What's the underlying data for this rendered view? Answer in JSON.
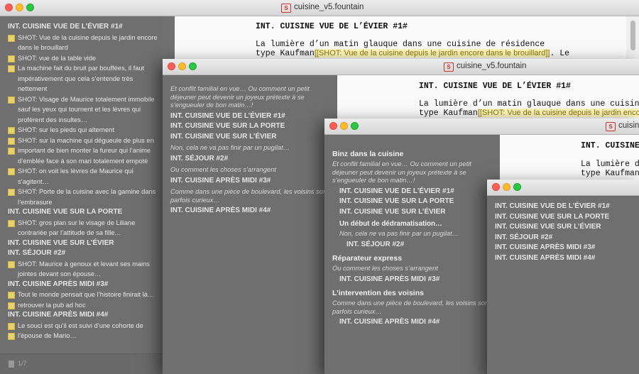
{
  "filename": "cuisine_v5.fountain",
  "app_icon": "S",
  "footer_page": "1/7",
  "win1": {
    "items": [
      {
        "kind": "scene",
        "text": "INT. CUISINE VUE DE L’ÉVIER #1#"
      },
      {
        "kind": "shot",
        "text": "SHOT: Vue de la cuisine depuis le jardin encore dans le brouillard"
      },
      {
        "kind": "shot",
        "text": "SHOT: vue de la table vide"
      },
      {
        "kind": "shot",
        "text": "La machine fait du bruit par bouffées, il faut impérativement que cela s’entende très nettement"
      },
      {
        "kind": "shot",
        "text": "SHOT: Visage de Maurice totalement immobile sauf les yeux qui tournent et les lèvres qui profèrent des insultes…"
      },
      {
        "kind": "shot",
        "text": "SHOT: sur les pieds qui alternent"
      },
      {
        "kind": "shot",
        "text": "SHOT: sur la machine qui dégueule de plus en"
      },
      {
        "kind": "shot",
        "text": "important de bien monter la fureur qui l’anime d’emblée face à son mari totalement empoté"
      },
      {
        "kind": "shot",
        "text": "SHOT: on voit les lèvres de Maurice qui s’agitent…"
      },
      {
        "kind": "shot",
        "text": "SHOT: Porte de la cuisine avec la gamine dans l’embrasure"
      },
      {
        "kind": "scene",
        "text": "INT. CUISINE VUE SUR LA PORTE"
      },
      {
        "kind": "shot",
        "text": "SHOT: gros plan sur le visage de Liliane contrariée par l’attitude de sa fille…"
      },
      {
        "kind": "scene",
        "text": "INT. CUISINE VUE SUR L’ÉVIER"
      },
      {
        "kind": "scene",
        "text": "INT. SÉJOUR #2#"
      },
      {
        "kind": "shot",
        "text": "SHOT: Maurice à genoux et levant ses mains jointes devant son épouse…"
      },
      {
        "kind": "scene",
        "text": "INT. CUISINE APRÈS MIDI #3#"
      },
      {
        "kind": "shot",
        "text": "Tout le monde pensait que l’histoire finirait là…"
      },
      {
        "kind": "shot",
        "text": "retrouver la pub ad hoc"
      },
      {
        "kind": "scene",
        "text": "INT. CUISINE APRÈS MIDI #4#"
      },
      {
        "kind": "shot",
        "text": "Le souci est qu’il est suivi d’une cohorte de"
      },
      {
        "kind": "shot",
        "text": "l’épouse de Mario…"
      }
    ],
    "editor": {
      "heading": "INT. CUISINE VUE DE L’ÉVIER #1#",
      "line1": "La lumière d’un matin glauque dans une cuisine de résidence",
      "line2_pre": "type Kaufman",
      "line2_note": "[[SHOT: Vue de la cuisine depuis le jardin encore dans le brouillard]]",
      "line2_post": ". Le"
    }
  },
  "win2": {
    "items": [
      {
        "kind": "syn",
        "text": "Et conflit familial en vue… Ou comment un petit déjeuner peut devenir un joyeux prétexte à se s’engueuler de bon matin…!"
      },
      {
        "kind": "scene",
        "text": "INT. CUISINE VUE DE L’ÉVIER #1#"
      },
      {
        "kind": "scene",
        "text": "INT. CUISINE VUE SUR LA PORTE"
      },
      {
        "kind": "scene",
        "text": "INT. CUISINE VUE SUR L’ÉVIER"
      },
      {
        "kind": "syn",
        "text": "Non, cela ne va pas finir par un pugilat…"
      },
      {
        "kind": "scene",
        "text": "INT. SÉJOUR #2#"
      },
      {
        "kind": "syn",
        "text": "Ou comment les choses s’arrangent"
      },
      {
        "kind": "scene",
        "text": "INT. CUISINE APRÈS MIDI #3#"
      },
      {
        "kind": "syn",
        "text": "Comme dans une pièce de boulevard, les voisins sont parfois curieux…"
      },
      {
        "kind": "scene",
        "text": "INT. CUISINE APRÈS MIDI #4#"
      }
    ],
    "editor": {
      "heading": "INT. CUISINE VUE DE L’ÉVIER #1#",
      "line1": "La lumière d’un matin glauque dans une cuisine",
      "line2_pre": "type Kaufman",
      "line2_note": "[[SHOT: Vue de la cuisine depuis le jardin encore dans le"
    }
  },
  "win3": {
    "items": [
      {
        "kind": "sect",
        "text": "Binz dans la cuisine"
      },
      {
        "kind": "syn",
        "text": "Et conflit familial en vue… Ou comment un petit déjeuner peut devenir un joyeux prétexte à se s’engueuler de bon matin…!"
      },
      {
        "kind": "iscene",
        "text": "INT. CUISINE VUE DE L’ÉVIER #1#"
      },
      {
        "kind": "iscene",
        "text": "INT. CUISINE VUE SUR LA PORTE"
      },
      {
        "kind": "iscene",
        "text": "INT. CUISINE VUE SUR L’ÉVIER"
      },
      {
        "kind": "sub",
        "text": "Un début de dédramatisation…"
      },
      {
        "kind": "isyn",
        "text": "Non, cela ne va pas finir par un pugilat…"
      },
      {
        "kind": "iscene2",
        "text": "INT. SÉJOUR #2#"
      },
      {
        "kind": "sect",
        "text": "Réparateur express"
      },
      {
        "kind": "syn",
        "text": "Ou comment les choses s’arrangent"
      },
      {
        "kind": "iscene",
        "text": "INT. CUISINE APRÈS MIDI #3#"
      },
      {
        "kind": "sect",
        "text": "L’intervention des voisins"
      },
      {
        "kind": "syn",
        "text": "Comme dans une pièce de boulevard, les voisins sont parfois curieux…"
      },
      {
        "kind": "iscene",
        "text": "INT. CUISINE APRÈS MIDI #4#"
      }
    ],
    "editor": {
      "heading": "INT. CUISINE",
      "line1": "La lumière d",
      "line2_pre": "type Kaufman"
    },
    "title_partial": "cuisine"
  },
  "win4": {
    "items": [
      {
        "kind": "plain",
        "text": "INT. CUISINE VUE DE L’ÉVIER #1#"
      },
      {
        "kind": "plain",
        "text": "INT. CUISINE VUE SUR LA PORTE"
      },
      {
        "kind": "plain",
        "text": "INT. CUISINE VUE SUR L’ÉVIER"
      },
      {
        "kind": "plain",
        "text": "INT. SÉJOUR #2#"
      },
      {
        "kind": "plain",
        "text": "INT. CUISINE APRÈS MIDI #3#"
      },
      {
        "kind": "plain",
        "text": "INT. CUISINE APRÈS MIDI #4#"
      }
    ]
  }
}
